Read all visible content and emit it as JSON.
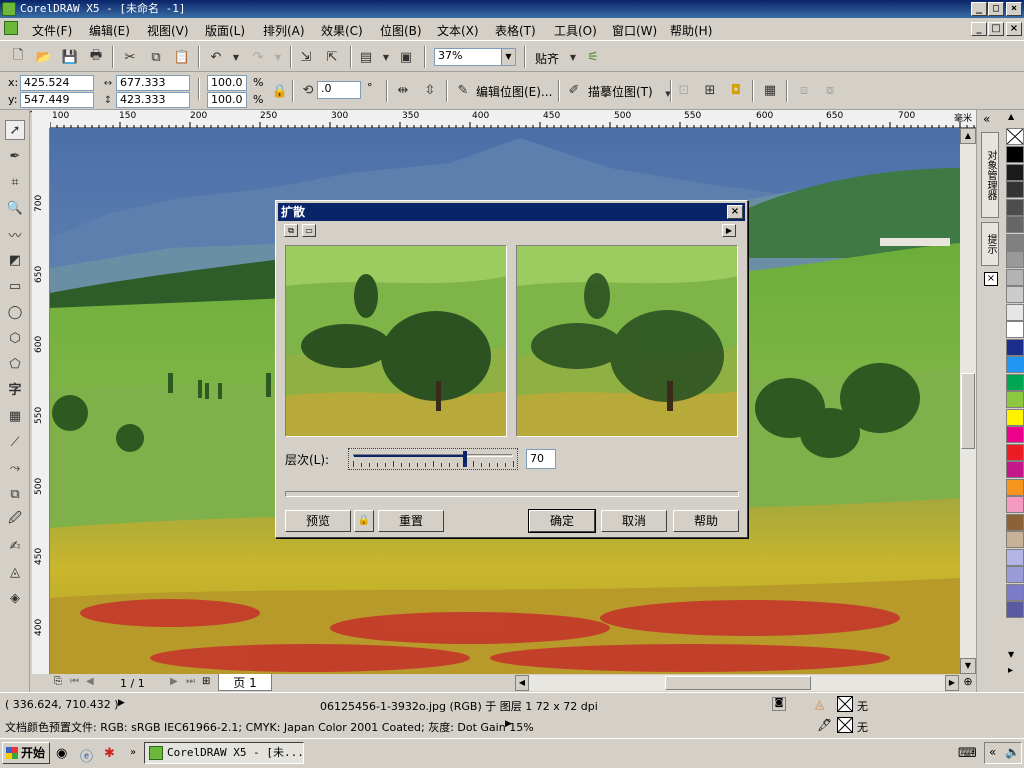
{
  "window": {
    "title": "CorelDRAW X5 - [未命名 -1]"
  },
  "menu": [
    "文件(F)",
    "编辑(E)",
    "视图(V)",
    "版面(L)",
    "排列(A)",
    "效果(C)",
    "位图(B)",
    "文本(X)",
    "表格(T)",
    "工具(O)",
    "窗口(W)",
    "帮助(H)"
  ],
  "toolbar1": {
    "zoom": "37%",
    "snap_label": "贴齐"
  },
  "toolbar2": {
    "x_label": "x:",
    "y_label": "y:",
    "x_value": "425.524 mm",
    "y_value": "547.449 mm",
    "width_value": "677.333 mm",
    "height_value": "423.333 mm",
    "scale_x": "100.0",
    "scale_y": "100.0",
    "percent": "%",
    "angle": ".0",
    "degree": "°",
    "edit_bitmap": "编辑位图(E)...",
    "trace_bitmap": "描摹位图(T)"
  },
  "rulers": {
    "h_ticks": [
      "100",
      "150",
      "200",
      "250",
      "300",
      "350",
      "400",
      "450",
      "500",
      "550",
      "600",
      "650",
      "700"
    ],
    "h_unit": "毫米",
    "v_ticks": [
      "700",
      "650",
      "600",
      "550",
      "500",
      "450",
      "400"
    ]
  },
  "docker": {
    "tab1": "对象管理器",
    "tab2": "提示"
  },
  "palette": [
    "#ffffff",
    "#000000",
    "#1a1a1a",
    "#333333",
    "#4d4d4d",
    "#666666",
    "#808080",
    "#999999",
    "#b3b3b3",
    "#cccccc",
    "#e6e6e6",
    "#ffffff",
    "#1b2e8c",
    "#2196f3",
    "#00a651",
    "#8dc63f",
    "#fff200",
    "#ec008c",
    "#ed1c24",
    "#c2188c",
    "#f7941d",
    "#f49ac1",
    "#8c6239",
    "#c7b299",
    "#b4b4e6",
    "#9b9bd7",
    "#7b7bc8",
    "#5a5aa0"
  ],
  "pagebar": {
    "page_count": "1 / 1",
    "page_tab": "页 1"
  },
  "status": {
    "coords": "( 336.624, 710.432 )",
    "object_info": "06125456-1-3932o.jpg (RGB) 于 图层 1 72 x 72 dpi",
    "color_profile": "文档颜色预置文件: RGB: sRGB IEC61966-2.1; CMYK: Japan Color 2001 Coated; 灰度: Dot Gain 15%",
    "fill_label": "无",
    "outline_label": "无"
  },
  "taskbar": {
    "start": "开始",
    "app_task": "CorelDRAW X5 - [未..."
  },
  "dialog": {
    "title": "扩散",
    "level_label": "层次(L):",
    "level_value": "70",
    "level_fraction": 0.7,
    "preview_button": "预览",
    "reset_button": "重置",
    "ok_button": "确定",
    "cancel_button": "取消",
    "help_button": "帮助"
  }
}
